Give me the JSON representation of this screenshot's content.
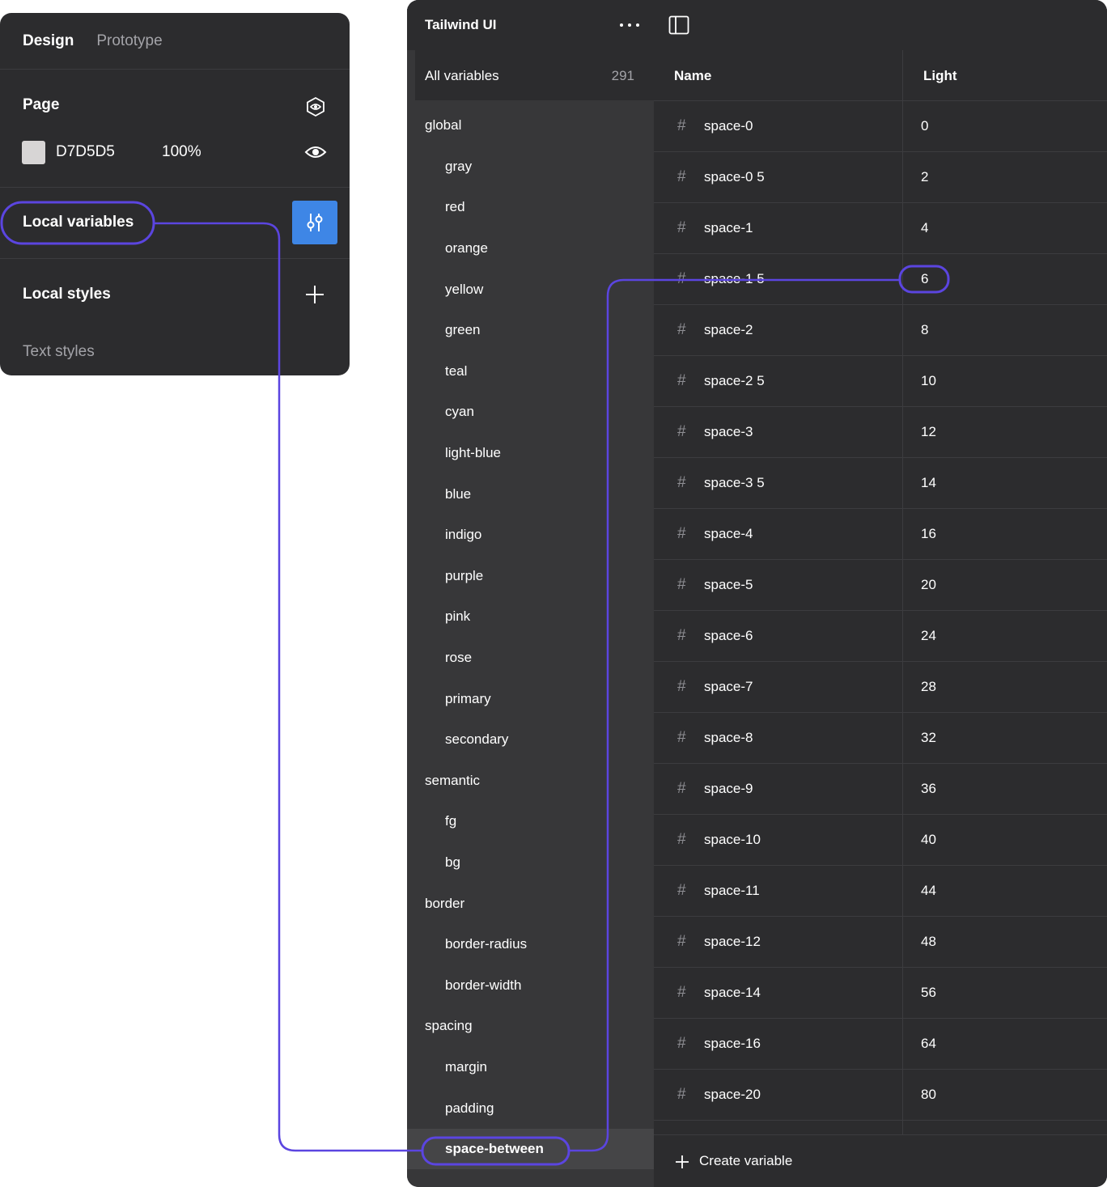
{
  "design_panel": {
    "tabs": [
      "Design",
      "Prototype"
    ],
    "page": {
      "title": "Page",
      "color_hex": "D7D5D5",
      "opacity": "100%",
      "swatch_color": "#d7d5d5"
    },
    "local_variables": {
      "title": "Local variables"
    },
    "local_styles": {
      "title": "Local styles",
      "text_styles": "Text styles"
    }
  },
  "variables_window": {
    "collection_title": "Tailwind UI",
    "all_variables": {
      "label": "All variables",
      "count": "291"
    },
    "groups": [
      {
        "label": "global",
        "level": "group"
      },
      {
        "label": "gray",
        "level": "child"
      },
      {
        "label": "red",
        "level": "child"
      },
      {
        "label": "orange",
        "level": "child"
      },
      {
        "label": "yellow",
        "level": "child"
      },
      {
        "label": "green",
        "level": "child"
      },
      {
        "label": "teal",
        "level": "child"
      },
      {
        "label": "cyan",
        "level": "child"
      },
      {
        "label": "light-blue",
        "level": "child"
      },
      {
        "label": "blue",
        "level": "child"
      },
      {
        "label": "indigo",
        "level": "child"
      },
      {
        "label": "purple",
        "level": "child"
      },
      {
        "label": "pink",
        "level": "child"
      },
      {
        "label": "rose",
        "level": "child"
      },
      {
        "label": "primary",
        "level": "child"
      },
      {
        "label": "secondary",
        "level": "child"
      },
      {
        "label": "semantic",
        "level": "group"
      },
      {
        "label": "fg",
        "level": "child"
      },
      {
        "label": "bg",
        "level": "child"
      },
      {
        "label": "border",
        "level": "group"
      },
      {
        "label": "border-radius",
        "level": "child"
      },
      {
        "label": "border-width",
        "level": "child"
      },
      {
        "label": "spacing",
        "level": "group"
      },
      {
        "label": "margin",
        "level": "child"
      },
      {
        "label": "padding",
        "level": "child"
      },
      {
        "label": "space-between",
        "level": "child",
        "selected": true
      }
    ],
    "table": {
      "headers": {
        "name": "Name",
        "mode": "Light"
      },
      "rows": [
        {
          "name": "space-0",
          "value": "0"
        },
        {
          "name": "space-0 5",
          "value": "2"
        },
        {
          "name": "space-1",
          "value": "4"
        },
        {
          "name": "space-1 5",
          "value": "6"
        },
        {
          "name": "space-2",
          "value": "8"
        },
        {
          "name": "space-2 5",
          "value": "10"
        },
        {
          "name": "space-3",
          "value": "12"
        },
        {
          "name": "space-3 5",
          "value": "14"
        },
        {
          "name": "space-4",
          "value": "16"
        },
        {
          "name": "space-5",
          "value": "20"
        },
        {
          "name": "space-6",
          "value": "24"
        },
        {
          "name": "space-7",
          "value": "28"
        },
        {
          "name": "space-8",
          "value": "32"
        },
        {
          "name": "space-9",
          "value": "36"
        },
        {
          "name": "space-10",
          "value": "40"
        },
        {
          "name": "space-11",
          "value": "44"
        },
        {
          "name": "space-12",
          "value": "48"
        },
        {
          "name": "space-14",
          "value": "56"
        },
        {
          "name": "space-16",
          "value": "64"
        },
        {
          "name": "space-20",
          "value": "80"
        }
      ]
    },
    "create_label": "Create variable"
  },
  "icons": {
    "page_settings": "hexagon-eye-icon",
    "visibility": "eye-icon",
    "variables_button": "sliders-icon",
    "add_style": "plus-icon",
    "more": "more-horizontal-icon",
    "panel_toggle": "sidebar-toggle-icon",
    "number_type": "hash-icon",
    "create": "plus-icon"
  },
  "colors": {
    "annotation": "#5b45e0",
    "accent_button": "#3e86e6",
    "panel_bg": "#2c2c2e",
    "sidebar_bg": "#373739"
  }
}
